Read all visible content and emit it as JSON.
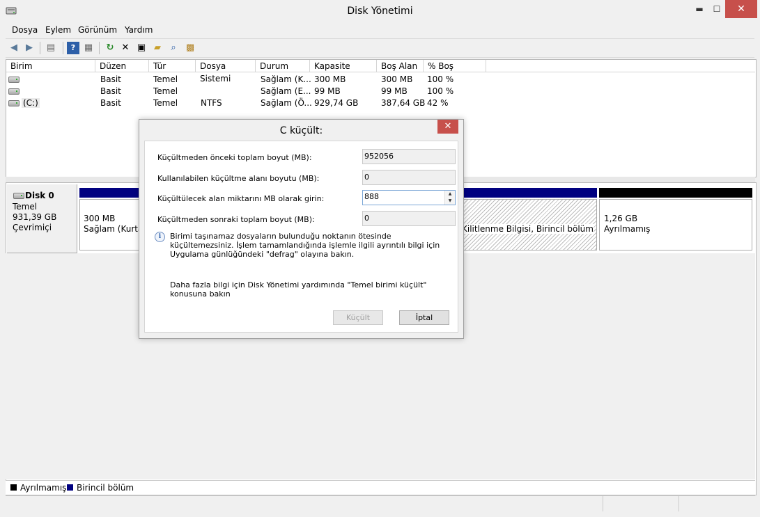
{
  "window": {
    "title": "Disk Yönetimi",
    "close_glyph": "✕",
    "min_glyph": "▬",
    "max_glyph": "☐"
  },
  "menu": [
    "Dosya",
    "Eylem",
    "Görünüm",
    "Yardım"
  ],
  "volume_list": {
    "columns": [
      "Birim",
      "Düzen",
      "Tür",
      "Dosya Sistemi",
      "Durum",
      "Kapasite",
      "Boş Alan",
      "% Boş"
    ],
    "rows": [
      {
        "birim": "",
        "duzen": "Basit",
        "tur": "Temel",
        "dosya": "",
        "durum": "Sağlam (K...",
        "kapasite": "300 MB",
        "bos": "300 MB",
        "yuzde": "100 %"
      },
      {
        "birim": "",
        "duzen": "Basit",
        "tur": "Temel",
        "dosya": "",
        "durum": "Sağlam (E...",
        "kapasite": "99 MB",
        "bos": "99 MB",
        "yuzde": "100 %"
      },
      {
        "birim": "(C:)",
        "duzen": "Basit",
        "tur": "Temel",
        "dosya": "NTFS",
        "durum": "Sağlam (Ö...",
        "kapasite": "929,74 GB",
        "bos": "387,64 GB",
        "yuzde": "42 %"
      }
    ]
  },
  "disk": {
    "name": "Disk 0",
    "type": "Temel",
    "size": "931,39 GB",
    "status": "Çevrimiçi",
    "partitions": [
      {
        "size": "300 MB",
        "desc": "Sağlam (Kurtar"
      },
      {
        "size": "",
        "desc": "Kilitlenme Bilgisi, Birincil bölüm"
      },
      {
        "size": "1,26 GB",
        "desc": "Ayrılmamış"
      }
    ]
  },
  "legend": [
    {
      "label": "Ayrılmamış",
      "color": "#000000"
    },
    {
      "label": "Birincil bölüm",
      "color": "#000080"
    }
  ],
  "dialog": {
    "title": "C küçült:",
    "fields": [
      {
        "label": "Küçültmeden önceki toplam boyut (MB):",
        "value": "952056"
      },
      {
        "label": "Kullanılabilen küçültme alanı boyutu (MB):",
        "value": "0"
      },
      {
        "label": "Küçültülecek alan miktarını MB olarak girin:",
        "value": "888"
      },
      {
        "label": "Küçültmeden sonraki toplam boyut (MB):",
        "value": "0"
      }
    ],
    "info_text": "Birimi taşınamaz dosyaların bulunduğu noktanın ötesinde küçültemezsiniz. İşlem tamamlandığında işlemle ilgili ayrıntılı bilgi için Uygulama günlüğündeki \"defrag\" olayına bakın.",
    "help_text": "Daha fazla bilgi için Disk Yönetimi yardımında \"Temel birimi küçült\" konusuna bakın",
    "shrink_label": "Küçült",
    "cancel_label": "İptal",
    "close_glyph": "✕"
  },
  "colors": {
    "primary_partition": "#000080",
    "unallocated": "#000000",
    "close_red": "#c7504b"
  }
}
